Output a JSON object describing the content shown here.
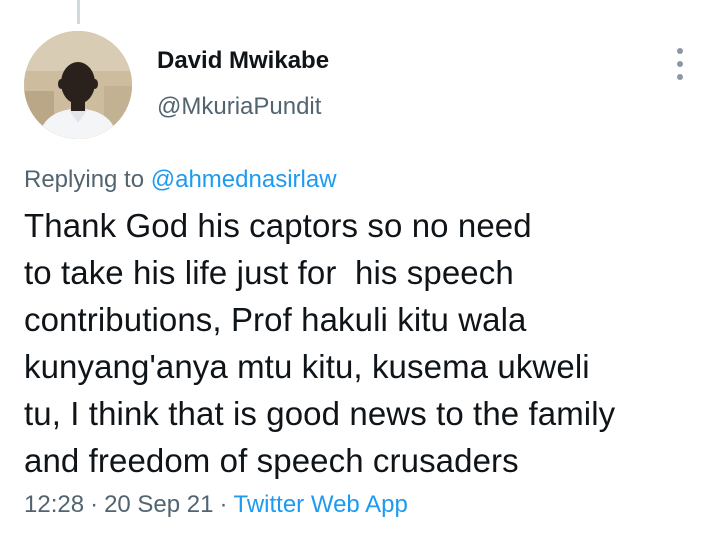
{
  "tweet": {
    "author": {
      "display_name": "David Mwikabe",
      "handle": "@MkuriaPundit"
    },
    "replying_prefix": "Replying to",
    "replying_to": "@ahmednasirlaw",
    "text_lines": [
      "Thank God his captors so no need",
      "to take his life just for  his speech",
      "contributions, Prof hakuli kitu wala",
      "kunyang'anya mtu kitu, kusema ukweli",
      "tu, I think that is good news to the family",
      "and freedom of speech crusaders"
    ],
    "time": "12:28",
    "date": "20 Sep 21",
    "separator": "·",
    "source": "Twitter Web App"
  },
  "icons": {
    "more": "more-vertical-icon",
    "avatar": "profile-photo"
  },
  "colors": {
    "text_primary": "#0f1419",
    "text_secondary": "#536471",
    "link": "#1d9bf0",
    "icon_muted": "#8b98a5"
  }
}
